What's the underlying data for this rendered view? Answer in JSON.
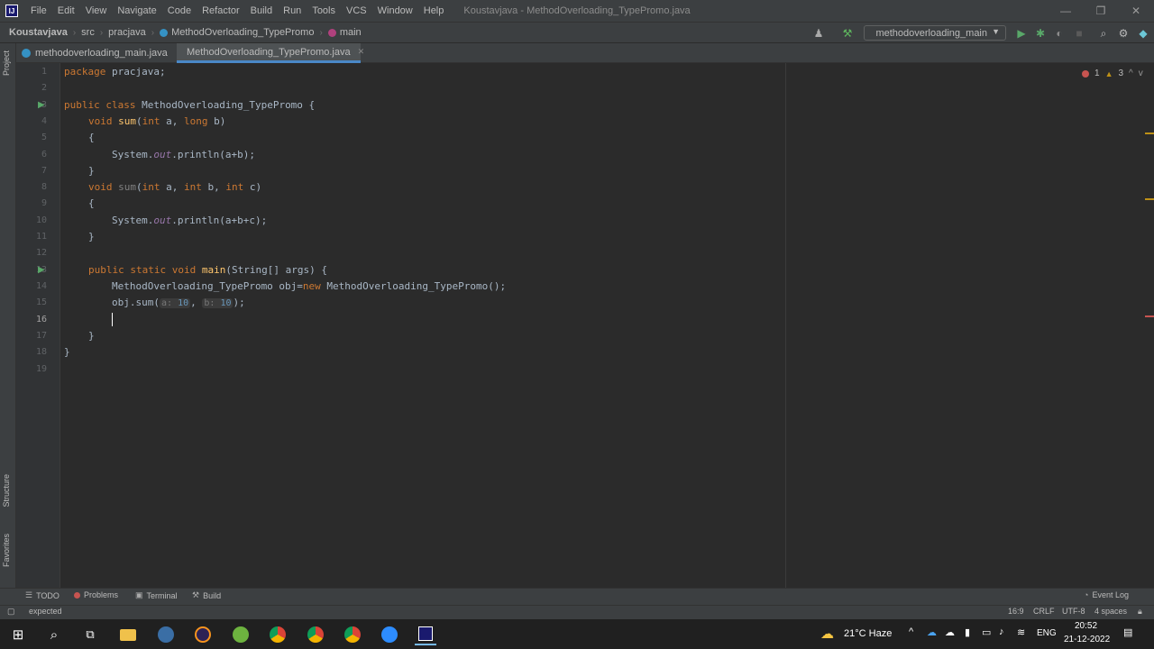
{
  "menu": {
    "items": [
      "File",
      "Edit",
      "View",
      "Navigate",
      "Code",
      "Refactor",
      "Build",
      "Run",
      "Tools",
      "VCS",
      "Window",
      "Help"
    ],
    "window_title": "Koustavjava - MethodOverloading_TypePromo.java"
  },
  "breadcrumbs": {
    "project": "Koustavjava",
    "src": "src",
    "package": "pracjava",
    "class": "MethodOverloading_TypePromo",
    "method": "main"
  },
  "run_config": {
    "label": "methodoverloading_main"
  },
  "tabs": [
    {
      "label": "methodoverloading_main.java",
      "active": false
    },
    {
      "label": "MethodOverloading_TypePromo.java",
      "active": true
    }
  ],
  "side_labels": {
    "project": "Project",
    "structure": "Structure",
    "favorites": "Favorites"
  },
  "gutter": {
    "line_numbers": [
      "1",
      "2",
      "3",
      "4",
      "5",
      "6",
      "7",
      "8",
      "9",
      "10",
      "11",
      "12",
      "13",
      "14",
      "15",
      "16",
      "17",
      "18",
      "19"
    ]
  },
  "code": {
    "l1_kw": "package",
    "l1_rest": " pracjava;",
    "l3_kw1": "public",
    "l3_kw2": " class",
    "l3_rest": " MethodOverloading_TypePromo {",
    "l4_kw": "void",
    "l4_fn": "sum",
    "l4_p1": "(",
    "l4_t1": "int",
    "l4_a": " a",
    "l4_comma": ",",
    "l4_t2": " long",
    "l4_b": " b",
    "l4_close": ")",
    "l5": "{",
    "l6_a": "System.",
    "l6_field": "out",
    "l6_b": ".println(a+b);",
    "l7": "}",
    "l8_kw": "void",
    "l8_fn": "sum",
    "l8_p1": "(",
    "l8_t1": "int",
    "l8_a": " a, ",
    "l8_t2": "int",
    "l8_b": " b, ",
    "l8_t3": "int",
    "l8_c": " c)",
    "l9": "{",
    "l10_a": "System.",
    "l10_field": "out",
    "l10_b": ".println(a+b+c);",
    "l11": "}",
    "l13_kw1": "public",
    "l13_kw2": " static",
    "l13_kw3": " void",
    "l13_fn": " main",
    "l13_rest": "(String[] args) {",
    "l14_a": "MethodOverloading_TypePromo obj=",
    "l14_kw": "new",
    "l14_b": " MethodOverloading_TypePromo();",
    "l15_a": "obj.sum(",
    "l15_h1": "a:",
    "l15_n1": "10",
    "l15_c": ", ",
    "l15_h2": "b:",
    "l15_n2": "10",
    "l15_end": ");",
    "l17": "}",
    "l18": "}"
  },
  "inspection": {
    "errors": "1",
    "warnings": "3"
  },
  "bottom_tools": {
    "todo": "TODO",
    "problems": "Problems",
    "terminal": "Terminal",
    "build": "Build",
    "event_log": "Event Log"
  },
  "status": {
    "message": "expected",
    "position": "16:9",
    "line_sep": "CRLF",
    "encoding": "UTF-8",
    "indent": "4 spaces"
  },
  "taskbar": {
    "weather": "21°C  Haze",
    "lang": "ENG",
    "time": "20:52",
    "date": "21-12-2022"
  },
  "colors": {
    "accent": "#4a88c7",
    "error": "#c75450",
    "keyword": "#cc7832",
    "function": "#ffc66d",
    "number": "#6897bb"
  }
}
